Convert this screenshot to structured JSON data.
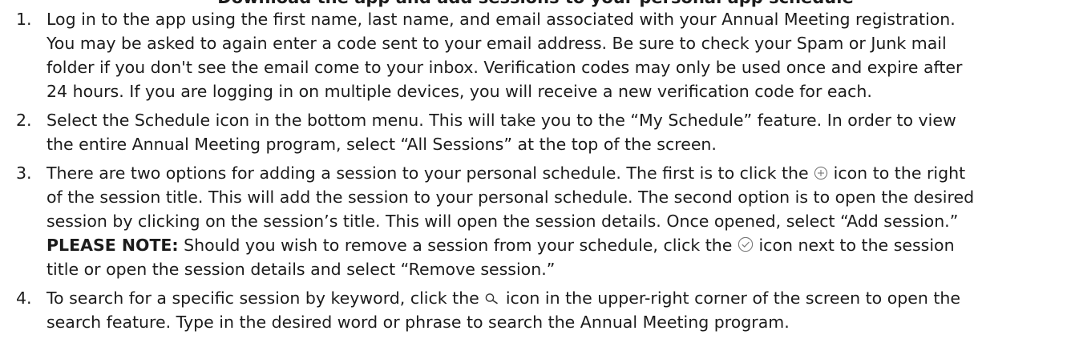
{
  "heading": "Download the app and add sessions to your personal app schedule",
  "icons": {
    "add": "plus-circle-icon",
    "added": "check-circle-icon",
    "search": "search-icon"
  },
  "steps": [
    {
      "num": "1.",
      "lines": [
        "Log in to the app using the first name, last name, and email associated with your Annual Meeting registration.",
        "You may be asked to again enter a code sent to your email address. Be sure to check your Spam or Junk mail",
        "folder if you don't see the email come to your inbox. Verification codes may only be used once and expire after",
        "24 hours. If you are logging in on multiple devices, you will receive a new verification code for each."
      ]
    },
    {
      "num": "2.",
      "lines": [
        "Select the Schedule icon in the bottom menu. This will take you to the “My Schedule” feature. In order to view",
        "the entire Annual Meeting program, select “All Sessions” at the top of the screen."
      ]
    },
    {
      "num": "3.",
      "l1a": "There are two options for adding a session to your personal schedule. The first is to click the",
      "l1b": "icon to the right",
      "l2": "of the session title. This will add the session to your personal schedule. The second option is to open the desired",
      "l3": "session by clicking on the session’s title. This will open the session details. Once opened, select “Add session.”",
      "note_label": "PLEASE NOTE:",
      "l4a": "Should you wish to remove a session from your schedule, click the",
      "l4b": "icon next to the session",
      "l5": "title or open the session details and select “Remove session.”"
    },
    {
      "num": "4.",
      "l1a": "To search for a specific session by keyword, click the",
      "l1b": "icon in the upper-right corner of the screen to open the",
      "l2": "search feature. Type in the desired word or phrase to search the Annual Meeting program."
    }
  ]
}
